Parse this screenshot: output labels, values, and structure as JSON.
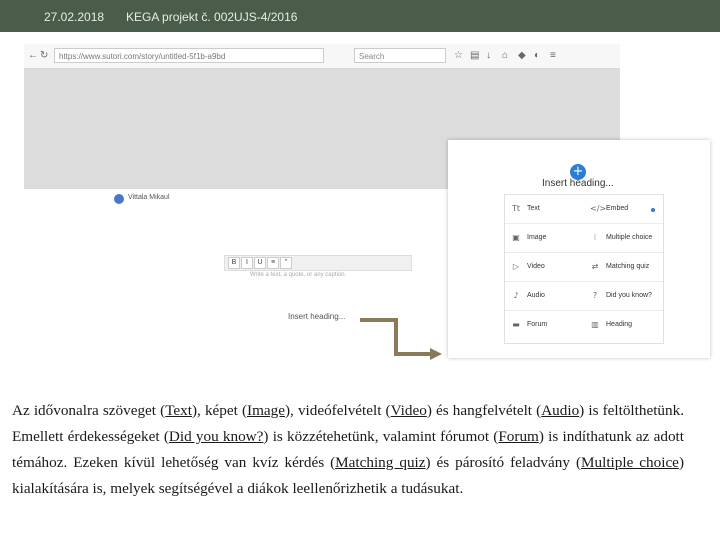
{
  "header": {
    "date": "27.02.2018",
    "title": "KEGA projekt č. 002UJS-4/2016"
  },
  "browser": {
    "url": "https://www.sutori.com/story/untitled-5f1b-a9bd",
    "search_placeholder": "Search"
  },
  "editor": {
    "author": "Vittala Mikaul",
    "editbar_buttons": [
      "B",
      "I",
      "U",
      "≡",
      "\""
    ],
    "placeholder": "Write a text, a quote, or any caption.",
    "insert_heading_small": "Insert heading..."
  },
  "insert_menu": {
    "plus": "+",
    "insert_heading": "Insert heading...",
    "items": [
      {
        "label": "Text",
        "icon": "text-icon"
      },
      {
        "label": "Embed",
        "icon": "embed-icon"
      },
      {
        "label": "Image",
        "icon": "image-icon"
      },
      {
        "label": "Multiple choice",
        "icon": "multiple-choice-icon"
      },
      {
        "label": "Video",
        "icon": "video-icon"
      },
      {
        "label": "Matching quiz",
        "icon": "matching-quiz-icon"
      },
      {
        "label": "Audio",
        "icon": "audio-icon"
      },
      {
        "label": "Did you know?",
        "icon": "did-you-know-icon"
      },
      {
        "label": "Forum",
        "icon": "forum-icon"
      },
      {
        "label": "Heading",
        "icon": "heading-icon"
      }
    ],
    "accent_color": "#2a7fd4"
  },
  "paragraph": {
    "p1": "Az idővonalra szöveget (",
    "text_link": "Text",
    "p2": "), képet (",
    "image_link": "Image",
    "p3": "), videófelvételt (",
    "video_link": "Video",
    "p4": ") és hangfelvételt (",
    "audio_link": "Audio",
    "p5": ") is feltölthetünk. Emellett érdekességeket (",
    "dyk_link": "Did you know?",
    "p6": ") is közzétehetünk, valamint fórumot (",
    "forum_link": "Forum",
    "p7": ") is indíthatunk az adott témához. Ezeken kívül lehetőség van kvíz kérdés (",
    "matching_link": "Matching quiz",
    "p8": ") és párosító feladvány (",
    "mc_link": "Multiple choice",
    "p9": ") kialakítására is, melyek segítségével a diákok leellenőrizhetik a tudásukat."
  },
  "colors": {
    "topbar": "#4a5d4a",
    "arrow": "#8a7a5a"
  }
}
